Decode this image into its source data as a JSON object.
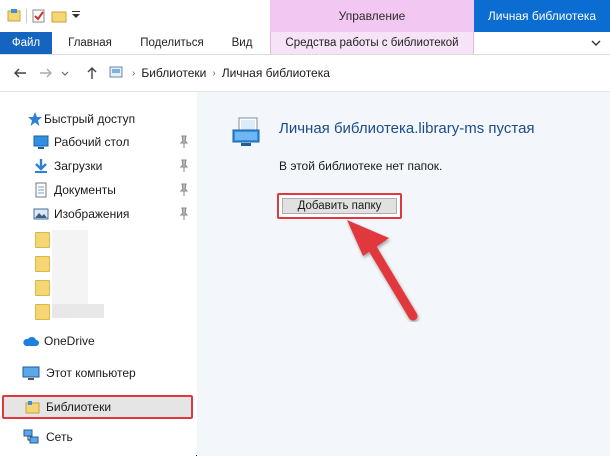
{
  "window": {
    "context_group": "Управление",
    "title": "Личная библиотека"
  },
  "ribbon": {
    "tabs": [
      {
        "label": "Файл"
      },
      {
        "label": "Главная"
      },
      {
        "label": "Поделиться"
      },
      {
        "label": "Вид"
      },
      {
        "label": "Средства работы с библиотекой"
      }
    ]
  },
  "address": {
    "breadcrumbs": [
      "Библиотеки",
      "Личная библиотека"
    ]
  },
  "nav": {
    "quick_access": "Быстрый доступ",
    "pinned": [
      {
        "label": "Рабочий стол",
        "icon": "desktop-icon"
      },
      {
        "label": "Загрузки",
        "icon": "downloads-icon"
      },
      {
        "label": "Документы",
        "icon": "documents-icon"
      },
      {
        "label": "Изображения",
        "icon": "pictures-icon"
      }
    ],
    "onedrive": "OneDrive",
    "this_pc": "Этот компьютер",
    "libraries": "Библиотеки",
    "network": "Сеть"
  },
  "content": {
    "title": "Личная библиотека.library-ms пустая",
    "description": "В этой библиотеке нет папок.",
    "add_folder_button": "Добавить папку"
  },
  "colors": {
    "accent": "#0b6cd1",
    "context_tab": "#f2c8f2",
    "highlight": "#e0393d",
    "link_title": "#1d4d8a"
  }
}
